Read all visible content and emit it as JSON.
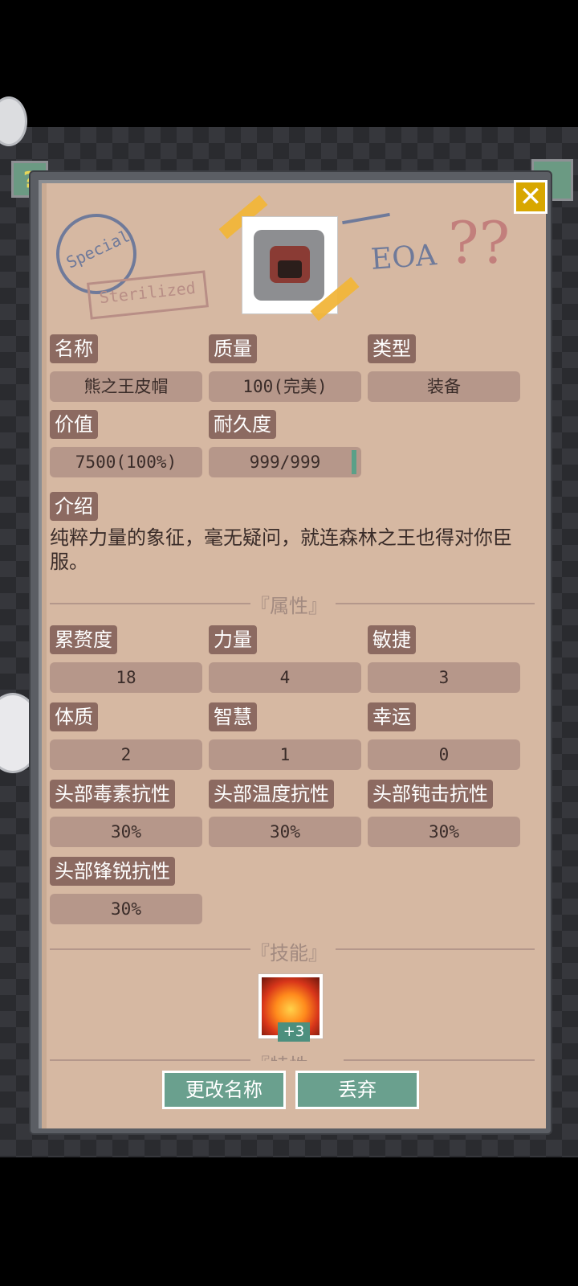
{
  "header": {
    "help_label": "?",
    "close_label": "✕",
    "stamp_text_top": "Special",
    "stamp_text_bottom": "Sterilized",
    "eoa_text": "EOA",
    "question_marks": "??"
  },
  "basic": {
    "name_label": "名称",
    "name_value": "熊之王皮帽",
    "quality_label": "质量",
    "quality_value": "100(完美)",
    "type_label": "类型",
    "type_value": "装备",
    "value_label": "价值",
    "value_value": "7500(100%)",
    "durability_label": "耐久度",
    "durability_value": "999/999"
  },
  "intro": {
    "label": "介绍",
    "text": "纯粹力量的象征，毫无疑问，就连森林之王也得对你臣服。"
  },
  "attributes": {
    "section_title": "『属性』",
    "items": [
      {
        "label": "累赘度",
        "value": "18"
      },
      {
        "label": "力量",
        "value": "4"
      },
      {
        "label": "敏捷",
        "value": "3"
      },
      {
        "label": "体质",
        "value": "2"
      },
      {
        "label": "智慧",
        "value": "1"
      },
      {
        "label": "幸运",
        "value": "0"
      },
      {
        "label": "头部毒素抗性",
        "value": "30%"
      },
      {
        "label": "头部温度抗性",
        "value": "30%"
      },
      {
        "label": "头部钝击抗性",
        "value": "30%"
      },
      {
        "label": "头部锋锐抗性",
        "value": "30%"
      }
    ]
  },
  "skills": {
    "section_title": "『技能』",
    "skill_badge": "+3",
    "next_section_partial": "『特性』"
  },
  "actions": {
    "rename_label": "更改名称",
    "discard_label": "丢弃"
  },
  "colors": {
    "paper": "#d6b8a2",
    "tag_bg": "#8c6a61",
    "value_bg": "#b6978a",
    "button_green": "#6aa08e",
    "close_yellow": "#d8a700"
  }
}
